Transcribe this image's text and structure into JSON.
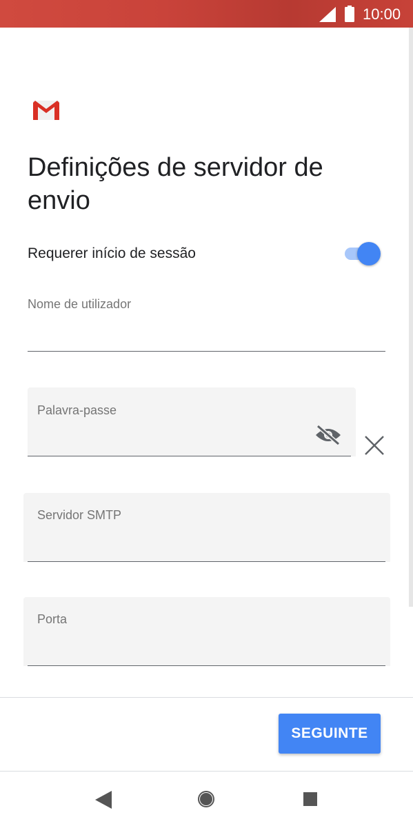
{
  "status_bar": {
    "time": "10:00",
    "icons": [
      "signal-icon",
      "battery-icon"
    ]
  },
  "app": {
    "logo": "gmail-logo"
  },
  "page": {
    "title": "Definições de servidor de envio"
  },
  "require_signin": {
    "label": "Requerer início de sessão",
    "enabled": true
  },
  "fields": {
    "username": {
      "label": "Nome de utilizador",
      "value": ""
    },
    "password": {
      "label": "Palavra-passe",
      "value": ""
    },
    "smtp_server": {
      "label": "Servidor SMTP",
      "value": ""
    },
    "port": {
      "label": "Porta",
      "value": ""
    }
  },
  "icons": {
    "password_visibility": "visibility-off-icon",
    "clear": "close-icon"
  },
  "footer": {
    "next_label": "SEGUINTE"
  },
  "nav_bar": {
    "icons": [
      "back-icon",
      "home-icon",
      "recents-icon"
    ]
  },
  "colors": {
    "status_bar": "#c9433a",
    "accent": "#4285f4",
    "toggle_track": "#a8c7fa"
  }
}
